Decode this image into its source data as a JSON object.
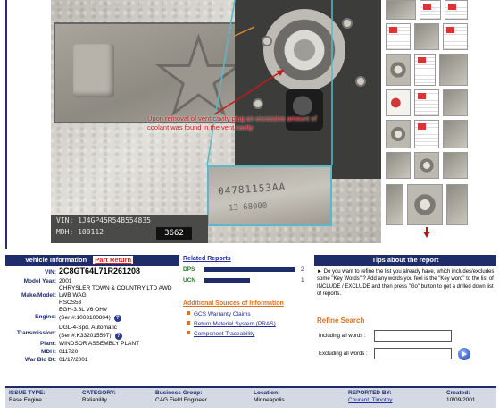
{
  "photo": {
    "caption": "Upon removal of vent cavity plug an excessive amount of coolant was found in the vent cavity",
    "vin_label": "VIN: 1J4GP45R54B554835",
    "mdh_label": "MDH: 100112",
    "plant_code": "3662",
    "part_number": "04781153AA",
    "part_number_2": "13 68000"
  },
  "vehicle": {
    "header": "Vehicle Information",
    "part_return": "Part Return",
    "vin_label": "VIN:",
    "vin": "2C8GT64L71R261208",
    "model_year_label": "Model Year:",
    "model_year": "2001",
    "make_model_label": "Make/Model:",
    "make_model": "CHRYSLER TOWN & COUNTRY LTD AWD LWB WAG",
    "make_model_code": "RSCS53",
    "engine_label": "Engine:",
    "engine": "EGH-3.8L V6 OHV",
    "engine_serial": "(Ser #:1003100804)",
    "transmission_label": "Transmission:",
    "transmission": "DGL-4-Spd. Automatic",
    "transmission_serial": "(Ser #:K332015597)",
    "plant_label": "Plant:",
    "plant": "WINDSOR ASSEMBLY PLANT",
    "mdh_label": "MDH:",
    "mdh": "011720",
    "war_bld_label": "War Bld Dt:",
    "war_bld": "01/17/2001"
  },
  "related": {
    "title": "Related Reports",
    "reports": [
      {
        "key": "DPS",
        "count": "2",
        "fraction": 1.0
      },
      {
        "key": "UCN",
        "count": "1",
        "fraction": 0.5
      }
    ],
    "sources_title": "Additional Sources of Information",
    "sources": [
      "GCS Warranty Claims",
      "Return Material System (PRAS)",
      "Component Traceability"
    ]
  },
  "tips": {
    "header": "Tips about the report",
    "text": "Do you want to refine the list you already have, which includes/excludes some \"Key Words\" ? Add any words you feel is the \"Key word\" to the list of INCLUDE / EXCLUDE and then press \"Go\" button to get a drilled down list of reports.",
    "refine_title": "Refine Search",
    "include_label": "Including all words :",
    "exclude_label": "Excluding all words :",
    "include_value": "",
    "exclude_value": ""
  },
  "footer": {
    "issue_type_label": "ISSUE TYPE:",
    "issue_type": "Base Engine",
    "category_label": "CATEGORY:",
    "category": "Reliability",
    "business_group_label": "Business Group:",
    "business_group": "CAG Field Engineer",
    "location_label": "Location:",
    "location": "Minneapolis",
    "reported_by_label": "REPORTED BY:",
    "reported_by": "Courant, Timothy",
    "created_label": "Created:",
    "created": "10/09/2001"
  },
  "colors": {
    "header_navy": "#1f2c6a",
    "caption_red": "#c21a1a",
    "accent_orange": "#e07020"
  },
  "icons": [
    "info-icon",
    "go-icon",
    "scroll-down-arrow-icon"
  ]
}
